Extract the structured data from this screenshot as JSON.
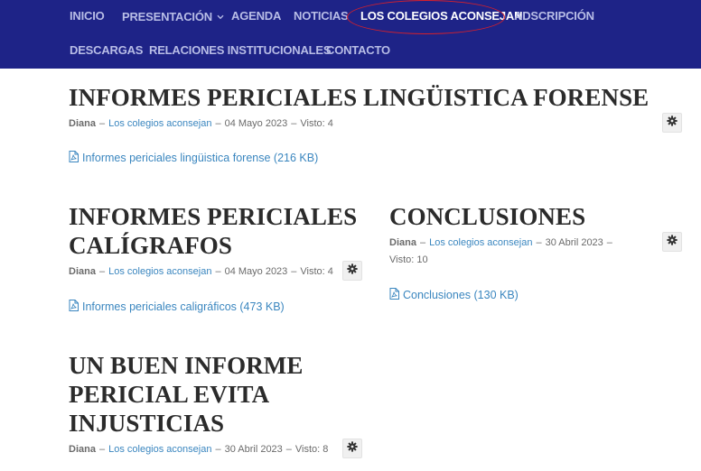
{
  "nav": {
    "items": [
      {
        "label": "INICIO"
      },
      {
        "label": "PRESENTACIÓN"
      },
      {
        "label": "AGENDA"
      },
      {
        "label": "NOTICIAS"
      },
      {
        "label": "LOS COLEGIOS ACONSEJAN"
      },
      {
        "label": "ADSCRIPCIÓN"
      },
      {
        "label": "DESCARGAS"
      },
      {
        "label": "RELACIONES INSTITUCIONALES"
      },
      {
        "label": "CONTACTO"
      }
    ],
    "active": "LOS COLEGIOS ACONSEJAN",
    "highlight_color": "#d8202a",
    "bg_color": "#1e2387"
  },
  "articles": [
    {
      "title": "INFORMES PERICIALES LINGÜISTICA FORENSE",
      "author": "Diana",
      "category": "Los colegios aconsejan",
      "date": "04 Mayo 2023",
      "views": "Visto: 4",
      "attachment": "Informes periciales lingüistica forense (216 KB)"
    },
    {
      "title_lines": [
        "INFORMES PERICIALES",
        "CALÍGRAFOS"
      ],
      "author": "Diana",
      "category": "Los colegios aconsejan",
      "date": "04 Mayo 2023",
      "views": "Visto: 4",
      "attachment": "Informes periciales caligráficos (473 KB)"
    },
    {
      "title": "CONCLUSIONES",
      "author": "Diana",
      "category": "Los colegios aconsejan",
      "date": "30 Abril 2023",
      "views": "Visto: 10",
      "attachment": "Conclusiones (130 KB)"
    },
    {
      "title_lines": [
        "UN BUEN INFORME",
        "PERICIAL EVITA",
        "INJUSTICIAS"
      ],
      "author": "Diana",
      "category": "Los colegios aconsejan",
      "date": "30 Abril 2023",
      "views": "Visto: 8"
    }
  ],
  "separator": "–",
  "icons": {
    "gear": "gear-icon",
    "pdf": "pdf-file-icon",
    "chevron": "chevron-down-icon"
  },
  "colors": {
    "link": "#3a86bf",
    "title": "#2b2b2b",
    "meta": "#6b6b6b"
  }
}
